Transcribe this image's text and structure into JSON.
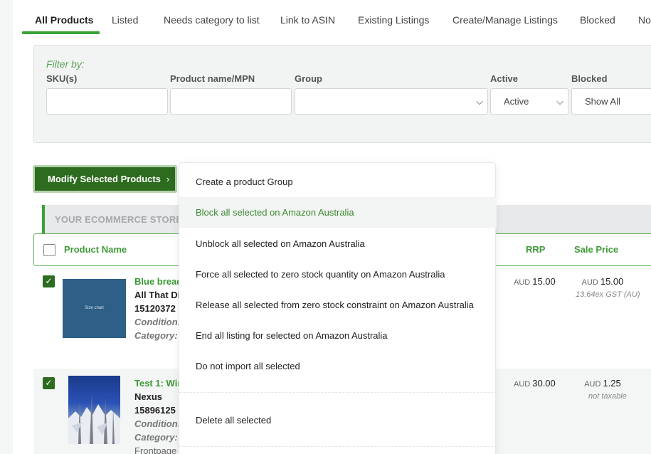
{
  "tabs": [
    {
      "label": "All Products",
      "active": true
    },
    {
      "label": "Listed"
    },
    {
      "label": "Needs category to list"
    },
    {
      "label": "Link to ASIN"
    },
    {
      "label": "Existing Listings"
    },
    {
      "label": "Create/Manage Listings"
    },
    {
      "label": "Blocked"
    },
    {
      "label": "No"
    }
  ],
  "filter": {
    "title": "Filter by:",
    "sku_label": "SKU(s)",
    "name_label": "Product name/MPN",
    "group_label": "Group",
    "active_label": "Active",
    "active_value": "Active",
    "blocked_label": "Blocked",
    "blocked_value": "Show All"
  },
  "modify_button": "Modify Selected Products",
  "modify_arrow": "›",
  "store_label": "YOUR ECOMMERCE STORE",
  "table": {
    "col_product": "Product Name",
    "col_rrp": "RRP",
    "col_sale": "Sale Price"
  },
  "rows": [
    {
      "name": "Blue bread",
      "line1": "All That Di",
      "line2": "15120372",
      "condition": "Condition:",
      "category": "Category:",
      "thumb_text": "Size chart",
      "rrp_currency": "AUD",
      "rrp": "15.00",
      "sale_currency": "AUD",
      "sale": "15.00",
      "sale_note": "13.64ex GST (AU)"
    },
    {
      "name": "Test 1: Wir",
      "line1": "Nexus",
      "line2": "15896125",
      "condition": "Condition:",
      "category": "Category:",
      "extra": "Frontpage",
      "rrp_currency": "AUD",
      "rrp": "30.00",
      "sale_currency": "AUD",
      "sale": "1.25",
      "sale_note": "not taxable"
    }
  ],
  "menu": {
    "items": [
      "Create a product Group",
      "Block all selected on Amazon Australia",
      "Unblock all selected on Amazon Australia",
      "Force all selected to zero stock quantity on Amazon Australia",
      "Release all selected from zero stock constraint on Amazon Australia",
      "End all listing for selected on Amazon Australia",
      "Do not import all selected"
    ],
    "delete": "Delete all selected"
  },
  "colors": {
    "accent": "#3aa335",
    "button": "#2d6b1f"
  }
}
